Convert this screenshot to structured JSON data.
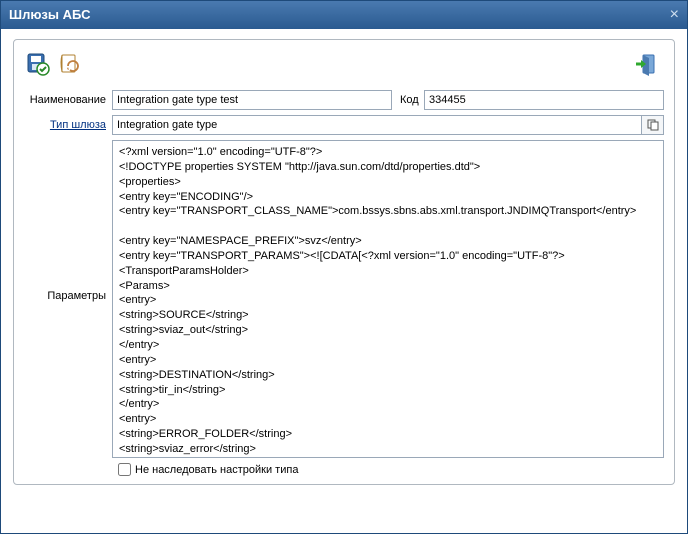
{
  "window": {
    "title": "Шлюзы АБС"
  },
  "toolbar": {
    "save_icon": "save-check-icon",
    "history_icon": "document-history-icon",
    "exit_icon": "exit-icon"
  },
  "form": {
    "name_label": "Наименование",
    "name_value": "Integration gate type test",
    "code_label": "Код",
    "code_value": "334455",
    "type_label": "Тип шлюза",
    "type_value": "Integration gate type",
    "params_label": "Параметры",
    "params_value": "<?xml version=\"1.0\" encoding=\"UTF-8\"?>\n<!DOCTYPE properties SYSTEM \"http://java.sun.com/dtd/properties.dtd\">\n<properties>\n<entry key=\"ENCODING\"/>\n<entry key=\"TRANSPORT_CLASS_NAME\">com.bssys.sbns.abs.xml.transport.JNDIMQTransport</entry>\n\n<entry key=\"NAMESPACE_PREFIX\">svz</entry>\n<entry key=\"TRANSPORT_PARAMS\"><![CDATA[<?xml version=\"1.0\" encoding=\"UTF-8\"?>\n<TransportParamsHolder>\n<Params>\n<entry>\n<string>SOURCE</string>\n<string>sviaz_out</string>\n</entry>\n<entry>\n<string>DESTINATION</string>\n<string>tir_in</string>\n</entry>\n<entry>\n<string>ERROR_FOLDER</string>\n<string>sviaz_error</string>\n</entry>",
    "inherit_label": "Не наследовать настройки типа",
    "inherit_checked": false
  }
}
